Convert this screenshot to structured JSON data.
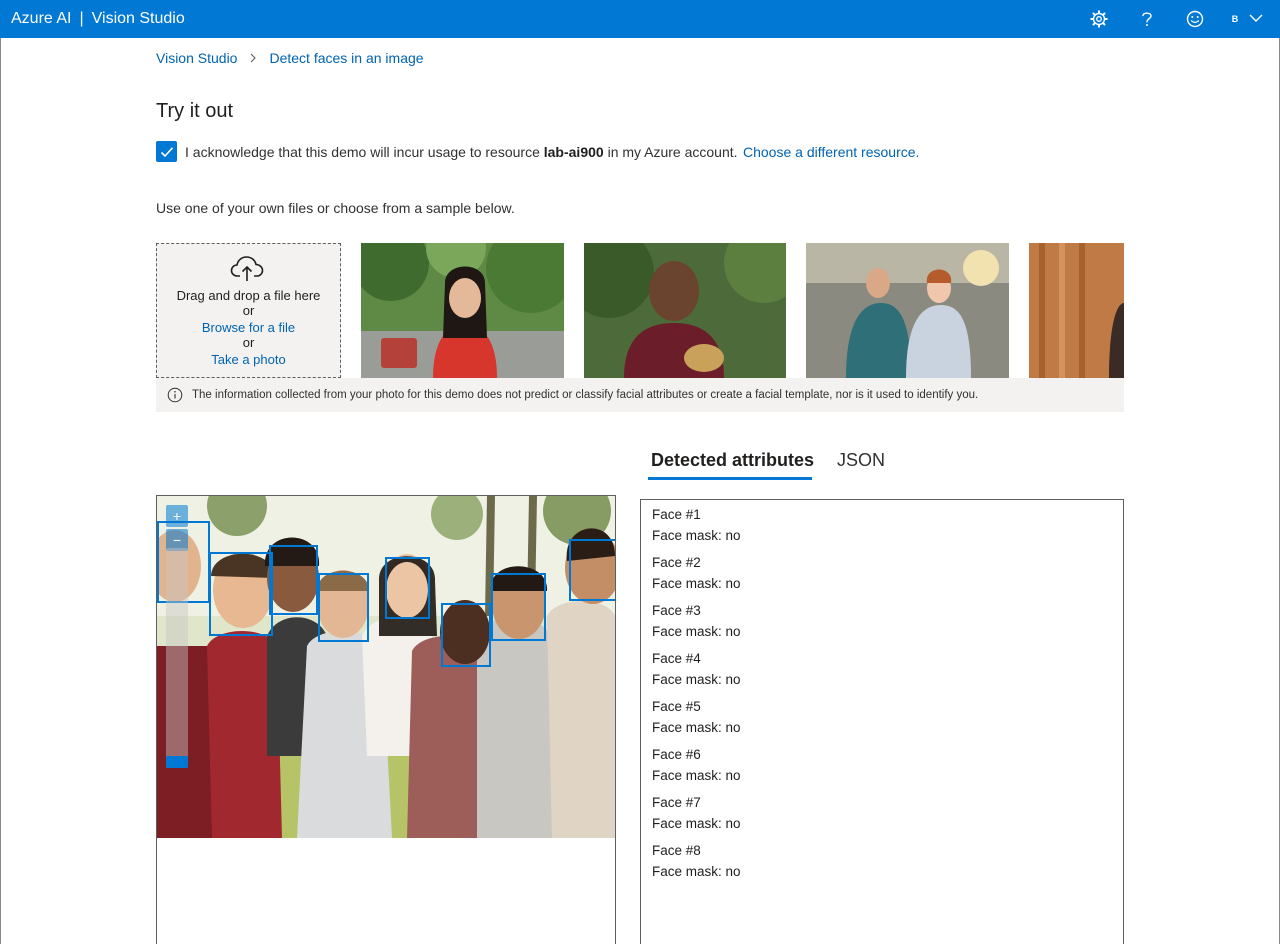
{
  "header": {
    "brand_left": "Azure AI",
    "brand_separator": "|",
    "brand_right": "Vision Studio",
    "avatar_initial": "B",
    "icons": [
      "gear-icon",
      "help-icon",
      "smiley-icon",
      "chevron-down-icon"
    ],
    "color": "#0078d4"
  },
  "breadcrumb": {
    "items": [
      "Vision Studio",
      "Detect faces in an image"
    ]
  },
  "page": {
    "title": "Try it out"
  },
  "acknowledge": {
    "checked": true,
    "text_before": "I acknowledge that this demo will incur usage to resource ",
    "resource": "lab-ai900",
    "text_after": " in my Azure account.",
    "link": "Choose a different resource."
  },
  "instructions": "Use one of your own files or choose from a sample below.",
  "upload": {
    "drag_text": "Drag and drop a file here",
    "or_1": "or",
    "browse_link": "Browse for a file",
    "or_2": "or",
    "photo_link": "Take a photo",
    "icon": "cloud-upload-icon"
  },
  "notice": {
    "text": "The information collected from your photo for this demo does not predict or classify facial attributes or create a facial template, nor is it used to identify you.",
    "icon": "info-icon"
  },
  "tabs": {
    "active": "Detected attributes",
    "inactive": "JSON"
  },
  "viewer": {
    "zoom_in": "+",
    "zoom_out": "−"
  },
  "faces": [
    {
      "label": "Face #1",
      "mask": "Face mask: no"
    },
    {
      "label": "Face #2",
      "mask": "Face mask: no"
    },
    {
      "label": "Face #3",
      "mask": "Face mask: no"
    },
    {
      "label": "Face #4",
      "mask": "Face mask: no"
    },
    {
      "label": "Face #5",
      "mask": "Face mask: no"
    },
    {
      "label": "Face #6",
      "mask": "Face mask: no"
    },
    {
      "label": "Face #7",
      "mask": "Face mask: no"
    },
    {
      "label": "Face #8",
      "mask": "Face mask: no"
    }
  ]
}
